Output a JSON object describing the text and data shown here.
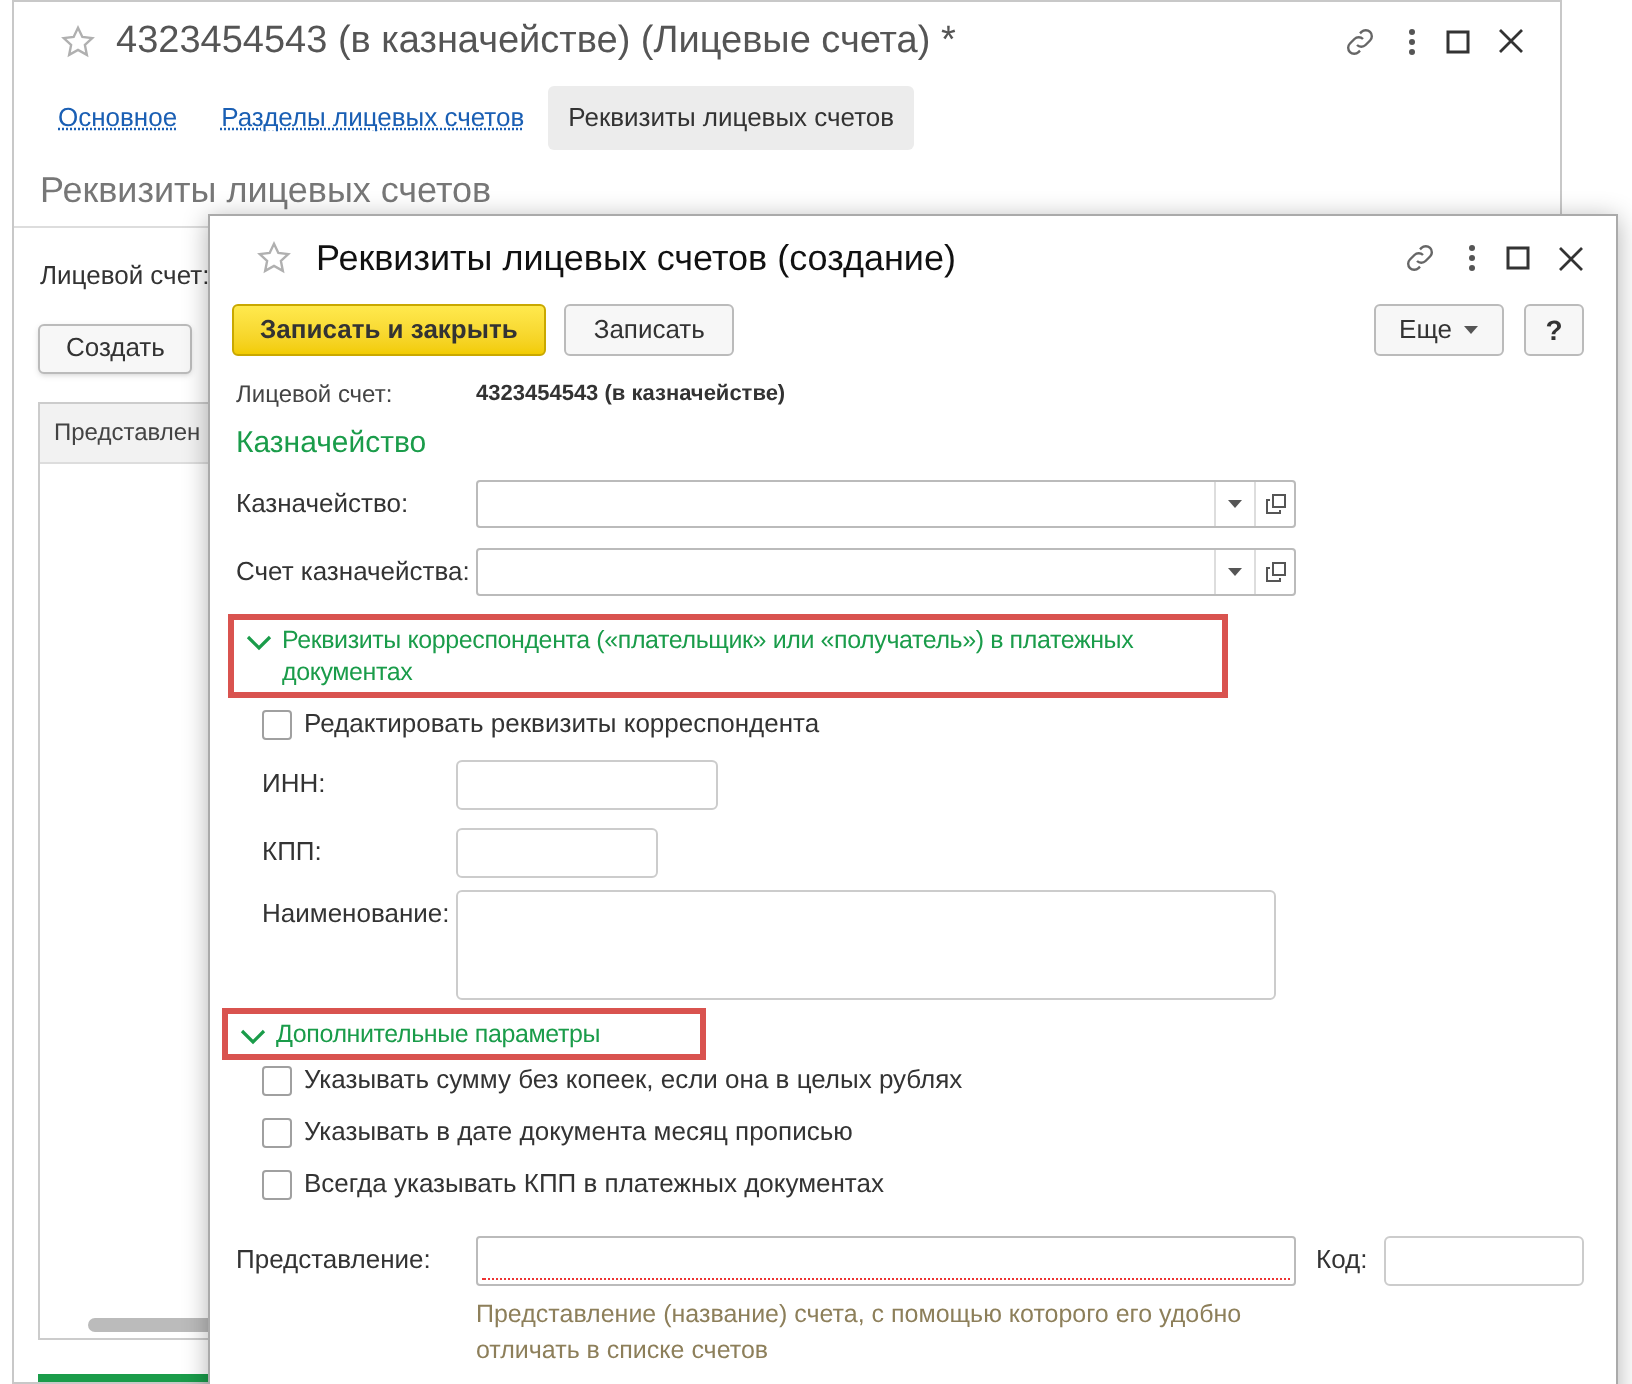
{
  "background_window": {
    "title": "4323454543 (в казначействе) (Лицевые счета) *",
    "tabs": [
      {
        "label": "Основное",
        "selected": false
      },
      {
        "label": "Разделы лицевых счетов",
        "selected": false
      },
      {
        "label": "Реквизиты лицевых счетов",
        "selected": true
      }
    ],
    "heading": "Реквизиты лицевых счетов",
    "account_label": "Лицевой счет:",
    "create_button": "Создать",
    "table": {
      "columns": [
        "Представлен"
      ]
    }
  },
  "dialog": {
    "title": "Реквизиты лицевых счетов (создание)",
    "buttons": [
      {
        "label": "Записать и закрыть",
        "kind": "primary"
      },
      {
        "label": "Записать",
        "kind": "normal"
      }
    ],
    "more_button": "Еще",
    "help_button": "?",
    "account": {
      "label": "Лицевой счет:",
      "value": "4323454543 (в казначействе)"
    },
    "section_title": "Казначейство",
    "fields": [
      {
        "label": "Казначейство:"
      },
      {
        "label": "Счет казначейства:"
      }
    ],
    "groups": [
      {
        "title": "Реквизиты корреспондента («плательщик» или «получатель») в платежных документах",
        "expanded": true,
        "highlighted": true,
        "items": [
          {
            "kind": "checkbox",
            "label": "Редактировать реквизиты корреспондента",
            "checked": false
          },
          {
            "kind": "input",
            "label": "ИНН:"
          },
          {
            "kind": "input",
            "label": "КПП:"
          },
          {
            "kind": "textarea",
            "label": "Наименование:"
          }
        ]
      },
      {
        "title": "Дополнительные параметры",
        "expanded": true,
        "highlighted": true,
        "items": [
          {
            "kind": "checkbox",
            "label": "Указывать сумму без копеек, если она в целых рублях",
            "checked": false
          },
          {
            "kind": "checkbox",
            "label": "Указывать в дате документа месяц прописью",
            "checked": false
          },
          {
            "kind": "checkbox",
            "label": "Всегда указывать КПП в платежных документах",
            "checked": false
          }
        ]
      }
    ],
    "presentation": {
      "label": "Представление:",
      "required": true,
      "hint": "Представление (название) счета, с помощью которого его удобно отличать в списке счетов"
    },
    "code": {
      "label": "Код:"
    }
  }
}
